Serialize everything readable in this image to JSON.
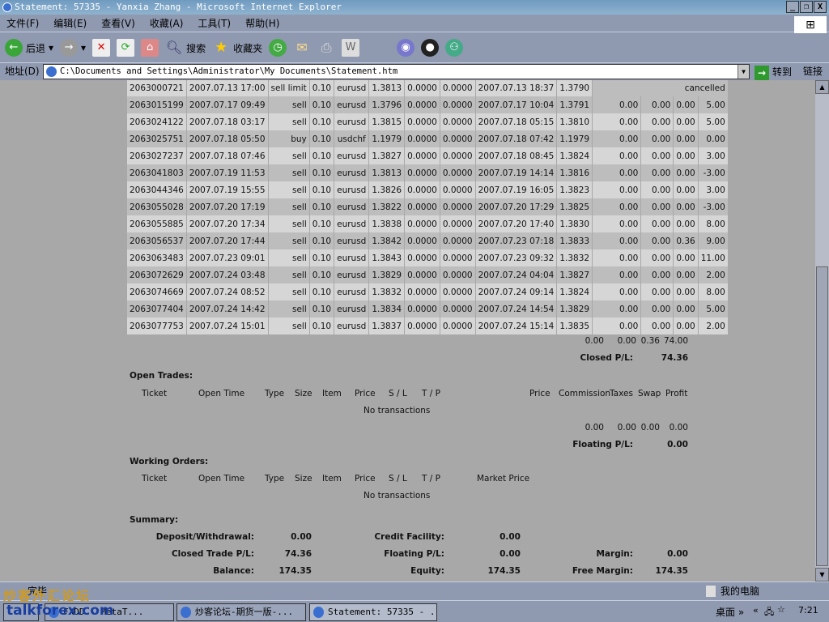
{
  "window": {
    "title": "Statement: 57335 - Yanxia Zhang - Microsoft Internet Explorer",
    "min": "_",
    "max": "❐",
    "close": "X"
  },
  "menu": [
    "文件(F)",
    "编辑(E)",
    "查看(V)",
    "收藏(A)",
    "工具(T)",
    "帮助(H)"
  ],
  "toolbar": {
    "back": "后退",
    "search": "搜索",
    "favorites": "收藏夹"
  },
  "address": {
    "label": "地址(D)",
    "value": "C:\\Documents and Settings\\Administrator\\My Documents\\Statement.htm",
    "go": "转到",
    "links": "链接"
  },
  "closed_rows": [
    [
      "2063000721",
      "2007.07.13 17:00",
      "sell limit",
      "0.10",
      "eurusd",
      "1.3813",
      "0.0000",
      "0.0000",
      "2007.07.13 18:37",
      "1.3790",
      "",
      "",
      "",
      "cancelled"
    ],
    [
      "2063015199",
      "2007.07.17 09:49",
      "sell",
      "0.10",
      "eurusd",
      "1.3796",
      "0.0000",
      "0.0000",
      "2007.07.17 10:04",
      "1.3791",
      "0.00",
      "0.00",
      "0.00",
      "5.00"
    ],
    [
      "2063024122",
      "2007.07.18 03:17",
      "sell",
      "0.10",
      "eurusd",
      "1.3815",
      "0.0000",
      "0.0000",
      "2007.07.18 05:15",
      "1.3810",
      "0.00",
      "0.00",
      "0.00",
      "5.00"
    ],
    [
      "2063025751",
      "2007.07.18 05:50",
      "buy",
      "0.10",
      "usdchf",
      "1.1979",
      "0.0000",
      "0.0000",
      "2007.07.18 07:42",
      "1.1979",
      "0.00",
      "0.00",
      "0.00",
      "0.00"
    ],
    [
      "2063027237",
      "2007.07.18 07:46",
      "sell",
      "0.10",
      "eurusd",
      "1.3827",
      "0.0000",
      "0.0000",
      "2007.07.18 08:45",
      "1.3824",
      "0.00",
      "0.00",
      "0.00",
      "3.00"
    ],
    [
      "2063041803",
      "2007.07.19 11:53",
      "sell",
      "0.10",
      "eurusd",
      "1.3813",
      "0.0000",
      "0.0000",
      "2007.07.19 14:14",
      "1.3816",
      "0.00",
      "0.00",
      "0.00",
      "-3.00"
    ],
    [
      "2063044346",
      "2007.07.19 15:55",
      "sell",
      "0.10",
      "eurusd",
      "1.3826",
      "0.0000",
      "0.0000",
      "2007.07.19 16:05",
      "1.3823",
      "0.00",
      "0.00",
      "0.00",
      "3.00"
    ],
    [
      "2063055028",
      "2007.07.20 17:19",
      "sell",
      "0.10",
      "eurusd",
      "1.3822",
      "0.0000",
      "0.0000",
      "2007.07.20 17:29",
      "1.3825",
      "0.00",
      "0.00",
      "0.00",
      "-3.00"
    ],
    [
      "2063055885",
      "2007.07.20 17:34",
      "sell",
      "0.10",
      "eurusd",
      "1.3838",
      "0.0000",
      "0.0000",
      "2007.07.20 17:40",
      "1.3830",
      "0.00",
      "0.00",
      "0.00",
      "8.00"
    ],
    [
      "2063056537",
      "2007.07.20 17:44",
      "sell",
      "0.10",
      "eurusd",
      "1.3842",
      "0.0000",
      "0.0000",
      "2007.07.23 07:18",
      "1.3833",
      "0.00",
      "0.00",
      "0.36",
      "9.00"
    ],
    [
      "2063063483",
      "2007.07.23 09:01",
      "sell",
      "0.10",
      "eurusd",
      "1.3843",
      "0.0000",
      "0.0000",
      "2007.07.23 09:32",
      "1.3832",
      "0.00",
      "0.00",
      "0.00",
      "11.00"
    ],
    [
      "2063072629",
      "2007.07.24 03:48",
      "sell",
      "0.10",
      "eurusd",
      "1.3829",
      "0.0000",
      "0.0000",
      "2007.07.24 04:04",
      "1.3827",
      "0.00",
      "0.00",
      "0.00",
      "2.00"
    ],
    [
      "2063074669",
      "2007.07.24 08:52",
      "sell",
      "0.10",
      "eurusd",
      "1.3832",
      "0.0000",
      "0.0000",
      "2007.07.24 09:14",
      "1.3824",
      "0.00",
      "0.00",
      "0.00",
      "8.00"
    ],
    [
      "2063077404",
      "2007.07.24 14:42",
      "sell",
      "0.10",
      "eurusd",
      "1.3834",
      "0.0000",
      "0.0000",
      "2007.07.24 14:54",
      "1.3829",
      "0.00",
      "0.00",
      "0.00",
      "5.00"
    ],
    [
      "2063077753",
      "2007.07.24 15:01",
      "sell",
      "0.10",
      "eurusd",
      "1.3837",
      "0.0000",
      "0.0000",
      "2007.07.24 15:14",
      "1.3835",
      "0.00",
      "0.00",
      "0.00",
      "2.00"
    ]
  ],
  "closed_totals": {
    "commission": "0.00",
    "taxes": "0.00",
    "swap": "0.36",
    "profit": "74.00",
    "pl_label": "Closed P/L:",
    "pl_value": "74.36"
  },
  "open_trades": {
    "title": "Open Trades:",
    "headers": [
      "Ticket",
      "Open Time",
      "Type",
      "Size",
      "Item",
      "Price",
      "S / L",
      "T / P",
      "Price",
      "Commission",
      "Taxes",
      "Swap",
      "Profit"
    ],
    "empty": "No transactions",
    "totals": [
      "0.00",
      "0.00",
      "0.00",
      "0.00"
    ],
    "pl_label": "Floating P/L:",
    "pl_value": "0.00"
  },
  "working_orders": {
    "title": "Working Orders:",
    "headers": [
      "Ticket",
      "Open Time",
      "Type",
      "Size",
      "Item",
      "Price",
      "S / L",
      "T / P",
      "Market Price"
    ],
    "empty": "No transactions"
  },
  "summary": {
    "title": "Summary:",
    "deposit_label": "Deposit/Withdrawal:",
    "deposit": "0.00",
    "credit_label": "Credit Facility:",
    "credit": "0.00",
    "closed_label": "Closed Trade P/L:",
    "closed": "74.36",
    "floating_label": "Floating P/L:",
    "floating": "0.00",
    "margin_label": "Margin:",
    "margin": "0.00",
    "balance_label": "Balance:",
    "balance": "174.35",
    "equity_label": "Equity:",
    "equity": "174.35",
    "free_label": "Free Margin:",
    "free": "174.35"
  },
  "status": {
    "text": "完毕",
    "zone": "我的电脑"
  },
  "taskbar": {
    "tasks": [
      "FXDD - MetaT...",
      "炒客论坛-期货一版-...",
      "Statement: 57335 - ..."
    ],
    "desktop": "桌面",
    "clock": "7:21"
  },
  "watermark": {
    "cn": "炒客外汇论坛",
    "en": "talkforex.com"
  }
}
